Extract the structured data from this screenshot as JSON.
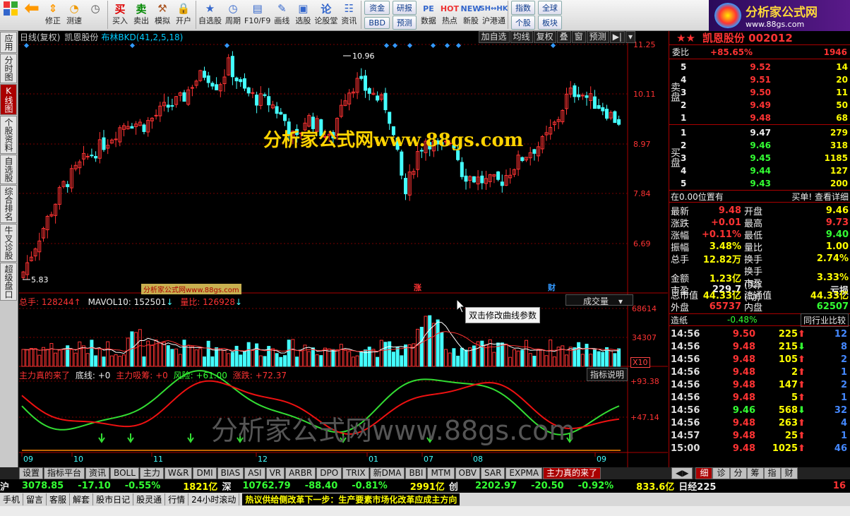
{
  "toolbar": {
    "buttons": [
      {
        "label": "",
        "icon": "grid-icon"
      },
      {
        "label": "",
        "icon": "back-icon"
      },
      {
        "label": "修正",
        "icon": "updown-icon"
      },
      {
        "label": "测速",
        "icon": "speed-icon"
      },
      {
        "label": "买入",
        "icon": "buy-icon"
      },
      {
        "label": "卖出",
        "icon": "sell-icon"
      },
      {
        "label": "模拟",
        "icon": "hammer-icon"
      },
      {
        "label": "开户",
        "icon": "lock-icon"
      },
      {
        "label": "自选股",
        "icon": "star-icon"
      },
      {
        "label": "周期",
        "icon": "clock-icon"
      },
      {
        "label": "F10/F9",
        "icon": "f10-icon"
      },
      {
        "label": "画线",
        "icon": "pencil-icon"
      },
      {
        "label": "选股",
        "icon": "select-icon"
      },
      {
        "label": "论股堂",
        "icon": "forum-icon"
      },
      {
        "label": "资讯",
        "icon": "info-icon"
      },
      {
        "label": "数据",
        "icon": "pe-icon"
      },
      {
        "label": "热点",
        "icon": "hot-icon"
      },
      {
        "label": "新股",
        "icon": "new-icon"
      },
      {
        "label": "沪港通",
        "icon": "hk-icon"
      }
    ],
    "pair1": [
      "资金",
      "BBD"
    ],
    "pair2": [
      "研报",
      "预测"
    ],
    "pair3": [
      "指数",
      "个股"
    ],
    "pair4": [
      "全球",
      "板块"
    ]
  },
  "logo": {
    "title": "分析家公式网",
    "url": "www.88gs.com"
  },
  "lefttabs": [
    "应用",
    "分时图",
    "K线图",
    "个股资料",
    "自选股",
    "综合排名",
    "牛叉诊股",
    "超级盘口"
  ],
  "chart": {
    "info_period": "日线(复权)",
    "info_name": "凯恩股份",
    "info_indicator": "布林BKD(41,2,5,18)",
    "buttons": [
      "加自选",
      "均线",
      "复权",
      "叠",
      "窗",
      "预测"
    ],
    "watermark_top": "分析家公式网www.88gs.com",
    "watermark_bottom": "分析家公式网www.88gs.com",
    "watermark_small": "分析家公式网www.88gs.com",
    "tooltip": "双击修改曲线参数",
    "vol_head": {
      "a": "总手: 128244",
      "b": "MAVOL10: 152501",
      "c": "量比: 126928"
    },
    "vol_dropdown": "成交量",
    "ind_head": {
      "a": "主力真的来了",
      "b": "底线: +0",
      "c": "主力吸筹: +0",
      "d": "风险: +61.00",
      "e": "涨跌: +72.37"
    },
    "ind_button": "指标说明",
    "x10": "X10",
    "markers": {
      "zhang": "涨",
      "cai": "财"
    },
    "hi_label": "10.96",
    "lo_label": "5.83"
  },
  "chart_data": {
    "type": "candlestick",
    "price_axis": [
      "11.25",
      "10.11",
      "8.97",
      "7.84",
      "6.69"
    ],
    "vol_axis": [
      "68614",
      "34307"
    ],
    "ind_axis": [
      "+93.38",
      "+47.14"
    ],
    "date_ticks": [
      "09",
      "10",
      "11",
      "12",
      "01",
      "07",
      "08",
      "09"
    ],
    "price_range": [
      5.6,
      11.3
    ],
    "high": 10.96,
    "low": 5.83
  },
  "right": {
    "header": "凯恩股份 002012",
    "ratio_label": "委比",
    "ratio_value": "+85.65%",
    "ratio_diff": "1946",
    "sell": [
      {
        "n": "5",
        "p": "9.52",
        "v": "14"
      },
      {
        "n": "4",
        "p": "9.51",
        "v": "20"
      },
      {
        "n": "3",
        "p": "9.50",
        "v": "11"
      },
      {
        "n": "2",
        "p": "9.49",
        "v": "50"
      },
      {
        "n": "1",
        "p": "9.48",
        "v": "68"
      }
    ],
    "buy": [
      {
        "n": "1",
        "p": "9.47",
        "v": "279"
      },
      {
        "n": "2",
        "p": "9.46",
        "v": "318"
      },
      {
        "n": "3",
        "p": "9.45",
        "v": "1185"
      },
      {
        "n": "4",
        "p": "9.44",
        "v": "127"
      },
      {
        "n": "5",
        "p": "9.43",
        "v": "200"
      }
    ],
    "sell_side": "卖盘",
    "buy_side": "买盘",
    "pos_label": "在0.00位置有",
    "pos_link": "买单! 查看详细",
    "stats": [
      [
        "最新",
        "9.48",
        "开盘",
        "9.46"
      ],
      [
        "涨跌",
        "+0.01",
        "最高",
        "9.73"
      ],
      [
        "涨幅",
        "+0.11%",
        "最低",
        "9.40"
      ],
      [
        "振幅",
        "3.48%",
        "量比",
        "1.00"
      ],
      [
        "总手",
        "12.82万",
        "换手",
        "2.74%"
      ],
      [
        "金额",
        "1.23亿",
        "换手(实)",
        "3.33%"
      ],
      [
        "市盈",
        "229.7",
        "市盈(动)",
        "亏损"
      ],
      [
        "总市值",
        "44.33亿",
        "流通值",
        "44.33亿"
      ],
      [
        "外盘",
        "65737",
        "内盘",
        "62507"
      ]
    ],
    "industry": "造纸",
    "industry_pct": "-0.48%",
    "industry_link": "同行业比较",
    "ticks": [
      {
        "t": "14:56",
        "p": "9.50",
        "v": "225",
        "d": "up",
        "n": "12"
      },
      {
        "t": "14:56",
        "p": "9.48",
        "v": "215",
        "d": "dn",
        "n": "8"
      },
      {
        "t": "14:56",
        "p": "9.48",
        "v": "105",
        "d": "up",
        "n": "2"
      },
      {
        "t": "14:56",
        "p": "9.48",
        "v": "2",
        "d": "up",
        "n": "1"
      },
      {
        "t": "14:56",
        "p": "9.48",
        "v": "147",
        "d": "up",
        "n": "2"
      },
      {
        "t": "14:56",
        "p": "9.48",
        "v": "5",
        "d": "up",
        "n": "1"
      },
      {
        "t": "14:56",
        "p": "9.46",
        "v": "568",
        "d": "dn",
        "n": "32"
      },
      {
        "t": "14:56",
        "p": "9.48",
        "v": "263",
        "d": "up",
        "n": "4"
      },
      {
        "t": "14:57",
        "p": "9.48",
        "v": "25",
        "d": "up",
        "n": "1"
      },
      {
        "t": "15:00",
        "p": "9.48",
        "v": "1025",
        "d": "up",
        "n": "46"
      }
    ]
  },
  "bottom_tabs": [
    "设置",
    "指标平台",
    "资讯",
    "BOLL",
    "主力",
    "W&R",
    "DMI",
    "BIAS",
    "ASI",
    "VR",
    "ARBR",
    "DPO",
    "TRIX",
    "新DMA",
    "BBI",
    "MTM",
    "OBV",
    "SAR",
    "EXPMA",
    "主力真的来了"
  ],
  "right_tabs": [
    "细",
    "诊",
    "分",
    "筹",
    "指",
    "财"
  ],
  "indices": {
    "sh_label": "沪",
    "sh_val": "3078.85",
    "sh_chg": "-17.10",
    "sh_pct": "-0.55%",
    "sh_amt": "1821亿",
    "sz_label": "深",
    "sz_val": "10762.79",
    "sz_chg": "-88.40",
    "sz_pct": "-0.81%",
    "sz_amt": "2991亿",
    "cy_label": "创",
    "cy_val": "2202.97",
    "cy_chg": "-20.50",
    "cy_pct": "-0.92%",
    "cy_amt": "833.6亿",
    "rj_label": "日经225",
    "rj_val": "16"
  },
  "status": {
    "items": [
      "手机",
      "留言",
      "客服",
      "解套",
      "股市日记",
      "股灵通",
      "行情",
      "24小时滚动"
    ],
    "news": "热议供给侧改革下一步：生产要素市场化改革应成主方向"
  }
}
